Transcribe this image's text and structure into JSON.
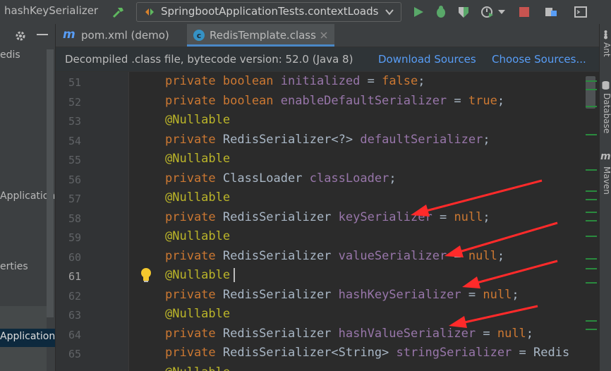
{
  "toolbar": {
    "title": "hashKeySerializer",
    "run_config": "SpringbootApplicationTests.contextLoads",
    "icons": [
      "build-hammer-icon",
      "run-config-icon",
      "run-icon",
      "debug-icon",
      "coverage-icon",
      "profile-icon",
      "dropdown-icon",
      "stop-icon",
      "project-structure-icon",
      "terminal-icon"
    ]
  },
  "left_panel": {
    "items": [
      "edis",
      "Application",
      "erties",
      "Application"
    ]
  },
  "tabs": [
    {
      "label": "pom.xml (demo)",
      "icon": "maven-m-icon"
    },
    {
      "label": "RedisTemplate.class",
      "icon": "class-c-icon",
      "active": true
    }
  ],
  "banner": {
    "message": "Decompiled .class file, bytecode version: 52.0 (Java 8)",
    "download_sources": "Download Sources",
    "choose_sources": "Choose Sources..."
  },
  "editor": {
    "current_line": "61",
    "lines": [
      {
        "n": "51",
        "tokens": [
          [
            "kw",
            "private boolean "
          ],
          [
            "fd",
            "initialized"
          ],
          [
            "pl",
            " = "
          ],
          [
            "kw",
            "false"
          ],
          [
            "pl",
            ";"
          ]
        ]
      },
      {
        "n": "52",
        "tokens": [
          [
            "kw",
            "private boolean "
          ],
          [
            "fd",
            "enableDefaultSerializer"
          ],
          [
            "pl",
            " = "
          ],
          [
            "kw",
            "true"
          ],
          [
            "pl",
            ";"
          ]
        ]
      },
      {
        "n": "53",
        "tokens": [
          [
            "an",
            "@Nullable"
          ]
        ]
      },
      {
        "n": "54",
        "tokens": [
          [
            "kw",
            "private "
          ],
          [
            "ty",
            "RedisSerializer<?> "
          ],
          [
            "fd",
            "defaultSerializer"
          ],
          [
            "pl",
            ";"
          ]
        ]
      },
      {
        "n": "55",
        "tokens": [
          [
            "an",
            "@Nullable"
          ]
        ]
      },
      {
        "n": "56",
        "tokens": [
          [
            "kw",
            "private "
          ],
          [
            "ty",
            "ClassLoader "
          ],
          [
            "fd",
            "classLoader"
          ],
          [
            "pl",
            ";"
          ]
        ]
      },
      {
        "n": "57",
        "tokens": [
          [
            "an",
            "@Nullable"
          ]
        ]
      },
      {
        "n": "58",
        "tokens": [
          [
            "kw",
            "private "
          ],
          [
            "ty",
            "RedisSerializer "
          ],
          [
            "fd",
            "keySerializer"
          ],
          [
            "pl",
            " = "
          ],
          [
            "kw",
            "null"
          ],
          [
            "pl",
            ";"
          ]
        ]
      },
      {
        "n": "59",
        "tokens": [
          [
            "an",
            "@Nullable"
          ]
        ]
      },
      {
        "n": "60",
        "tokens": [
          [
            "kw",
            "private "
          ],
          [
            "ty",
            "RedisSerializer "
          ],
          [
            "fd",
            "valueSerializer"
          ],
          [
            "pl",
            " = "
          ],
          [
            "kw",
            "null"
          ],
          [
            "pl",
            ";"
          ]
        ]
      },
      {
        "n": "61",
        "tokens": [
          [
            "an",
            "@Nullable"
          ]
        ]
      },
      {
        "n": "62",
        "tokens": [
          [
            "kw",
            "private "
          ],
          [
            "ty",
            "RedisSerializer "
          ],
          [
            "fd",
            "hashKeySerializer"
          ],
          [
            "pl",
            " = "
          ],
          [
            "kw",
            "null"
          ],
          [
            "pl",
            ";"
          ]
        ]
      },
      {
        "n": "63",
        "tokens": [
          [
            "an",
            "@Nullable"
          ]
        ]
      },
      {
        "n": "64",
        "tokens": [
          [
            "kw",
            "private "
          ],
          [
            "ty",
            "RedisSerializer "
          ],
          [
            "fd",
            "hashValueSerializer"
          ],
          [
            "pl",
            " = "
          ],
          [
            "kw",
            "null"
          ],
          [
            "pl",
            ";"
          ]
        ]
      },
      {
        "n": "65",
        "tokens": [
          [
            "kw",
            "private "
          ],
          [
            "ty",
            "RedisSerializer<String> "
          ],
          [
            "fd",
            "stringSerializer"
          ],
          [
            "pl",
            " = Redis"
          ]
        ]
      },
      {
        "n": "",
        "tokens": [
          [
            "an",
            "@Nullable"
          ]
        ]
      }
    ]
  },
  "right_tools": [
    "Ant",
    "Database",
    "Maven"
  ],
  "colors": {
    "keyword": "#cc7832",
    "annotation": "#bbb529",
    "field": "#9876aa",
    "plain": "#a9b7c6",
    "link": "#589df6",
    "arrow": "#ff2a2a"
  }
}
